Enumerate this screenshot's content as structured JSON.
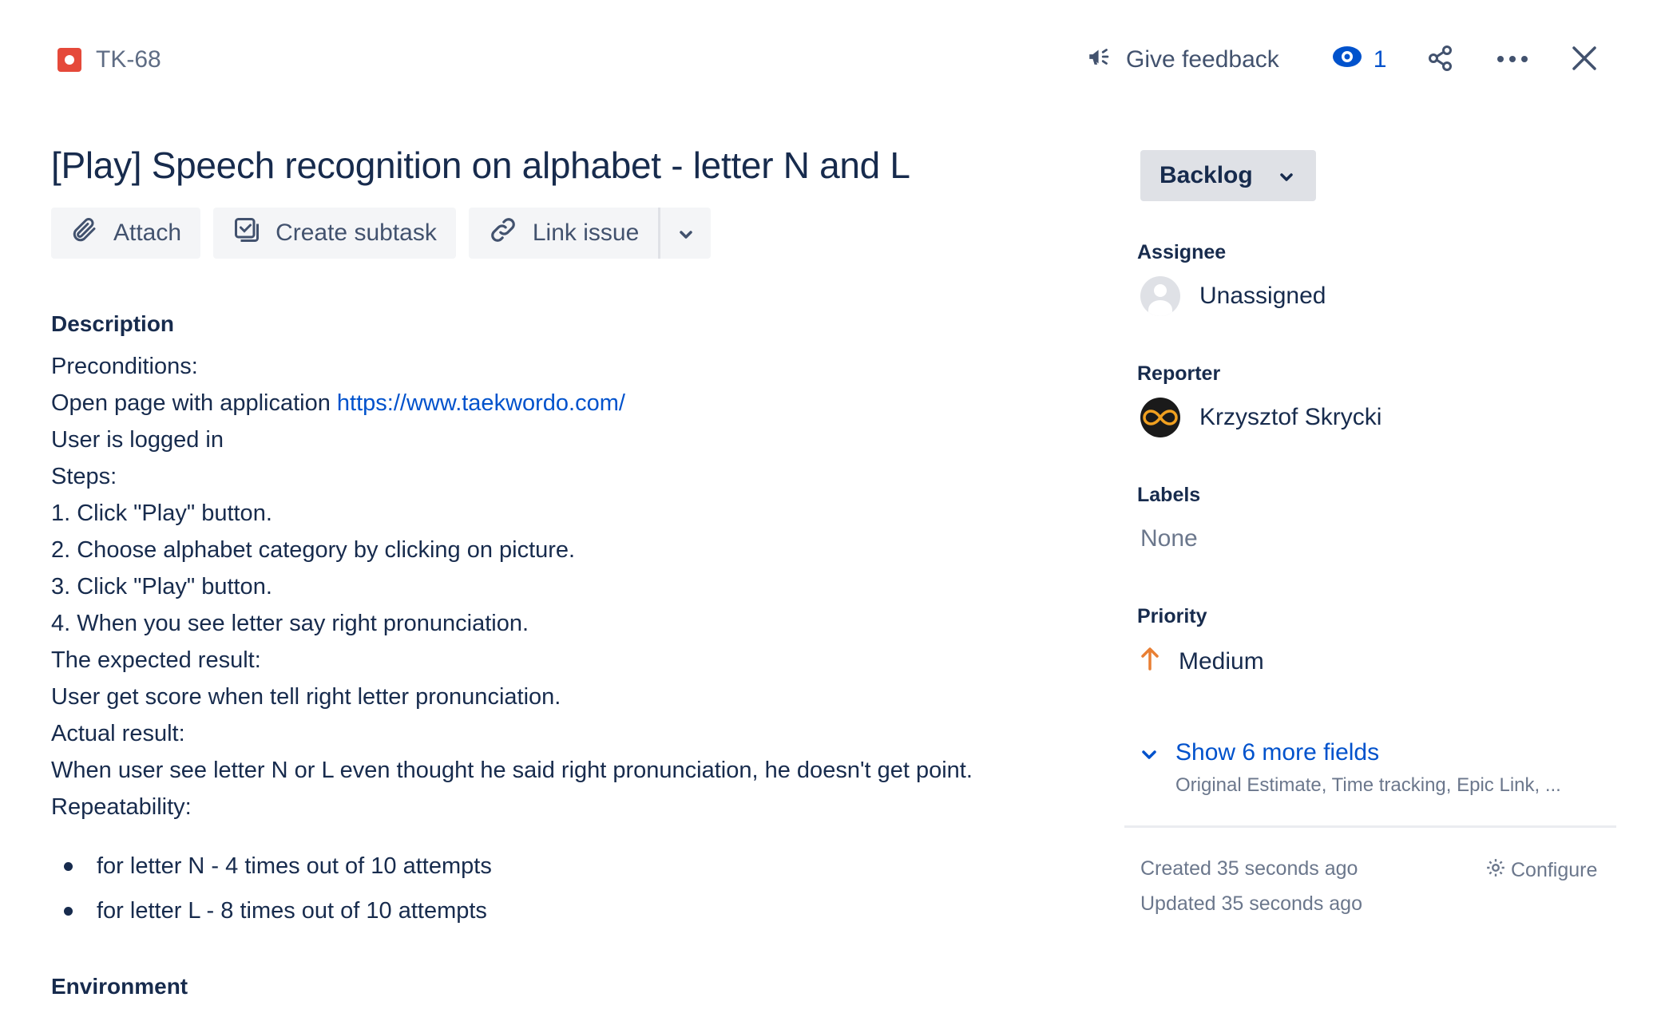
{
  "header": {
    "issue_key": "TK-68",
    "feedback_label": "Give feedback",
    "watch_count": "1"
  },
  "issue": {
    "title": "[Play] Speech recognition on alphabet - letter N and L",
    "status": "Backlog"
  },
  "toolbar": {
    "attach_label": "Attach",
    "subtask_label": "Create subtask",
    "link_label": "Link issue"
  },
  "description": {
    "heading": "Description",
    "preconditions": "Preconditions:",
    "open_page_prefix": "Open page with application ",
    "open_page_link": "https://www.taekwordo.com/",
    "logged_in": "User is logged in",
    "steps_label": "Steps:",
    "step1": "1. Click \"Play\" button.",
    "step2": "2. Choose alphabet category by clicking on picture.",
    "step3": "3. Click \"Play\" button.",
    "step4": "4. When you see letter say right pronunciation.",
    "expected_label": "The expected result:",
    "expected": "User get score when tell right letter pronunciation.",
    "actual_label": "Actual result:",
    "actual": "When user see letter N or L even thought he said right pronunciation, he doesn't get point.",
    "repeatability_label": "Repeatability:",
    "bullets": [
      "for letter N - 4 times out of 10 attempts",
      "for letter L - 8 times out of 10 attempts"
    ]
  },
  "environment": {
    "heading": "Environment"
  },
  "fields": {
    "assignee_label": "Assignee",
    "assignee_value": "Unassigned",
    "reporter_label": "Reporter",
    "reporter_value": "Krzysztof Skrycki",
    "labels_label": "Labels",
    "labels_value": "None",
    "priority_label": "Priority",
    "priority_value": "Medium",
    "more_fields_label": "Show 6 more fields",
    "more_fields_sub": "Original Estimate, Time tracking, Epic Link, ..."
  },
  "meta": {
    "created": "Created 35 seconds ago",
    "updated": "Updated 35 seconds ago",
    "configure": "Configure"
  },
  "colors": {
    "link": "#0052cc",
    "bug": "#e5493a",
    "priority_medium": "#e97f33",
    "text": "#172b4d"
  }
}
